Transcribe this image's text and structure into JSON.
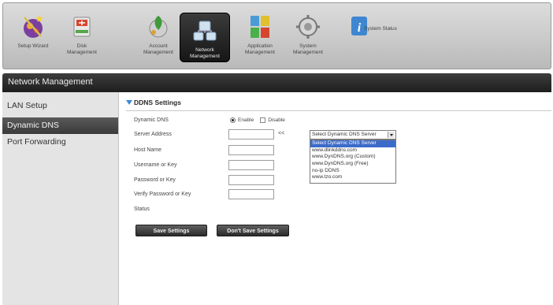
{
  "toolbar": {
    "items": [
      {
        "label": "Setup Wizard",
        "icon": "wizard-wand-icon"
      },
      {
        "label": "Disk\nManagement",
        "icon": "disk-management-icon"
      },
      {
        "label": "Account\nManagement",
        "icon": "account-management-icon"
      },
      {
        "label": "Network\nManagement",
        "icon": "network-management-icon"
      },
      {
        "label": "Application\nManagement",
        "icon": "application-management-icon"
      },
      {
        "label": "System\nManagement",
        "icon": "system-management-icon"
      },
      {
        "label": "System Status",
        "icon": "system-status-icon"
      }
    ],
    "active_index": 3
  },
  "section_title": "Network Management",
  "sidebar": {
    "items": [
      {
        "label": "LAN Setup"
      },
      {
        "label": "Dynamic DNS"
      },
      {
        "label": "Port Forwarding"
      }
    ],
    "active_index": 1
  },
  "ddns": {
    "title": "DDNS Settings",
    "dynamic_dns_label": "Dynamic DNS",
    "enable_label": "Enable",
    "disable_label": "Disable",
    "enable_checked": true,
    "server_address_label": "Server Address",
    "server_address_value": "",
    "arrows": "<<",
    "server_select_value": "Select Dynamic DNS Server",
    "server_options": [
      "Select Dynamic DNS Server",
      "www.dlinkddns.com",
      "www.DynDNS.org (Custom)",
      "www.DynDNS.org (Free)",
      "no-ip DDNS",
      "www.tzo.com"
    ],
    "host_name_label": "Host Name",
    "username_label": "Username or Key",
    "password_label": "Password or Key",
    "verify_password_label": "Verify Password or Key",
    "status_label": "Status",
    "save_button": "Save Settings",
    "dont_save_button": "Don't Save Settings"
  },
  "colors": {
    "accent": "#3a8ad6",
    "header_dark": "#1d1d1d",
    "dropdown_selected": "#3c6bc9"
  }
}
